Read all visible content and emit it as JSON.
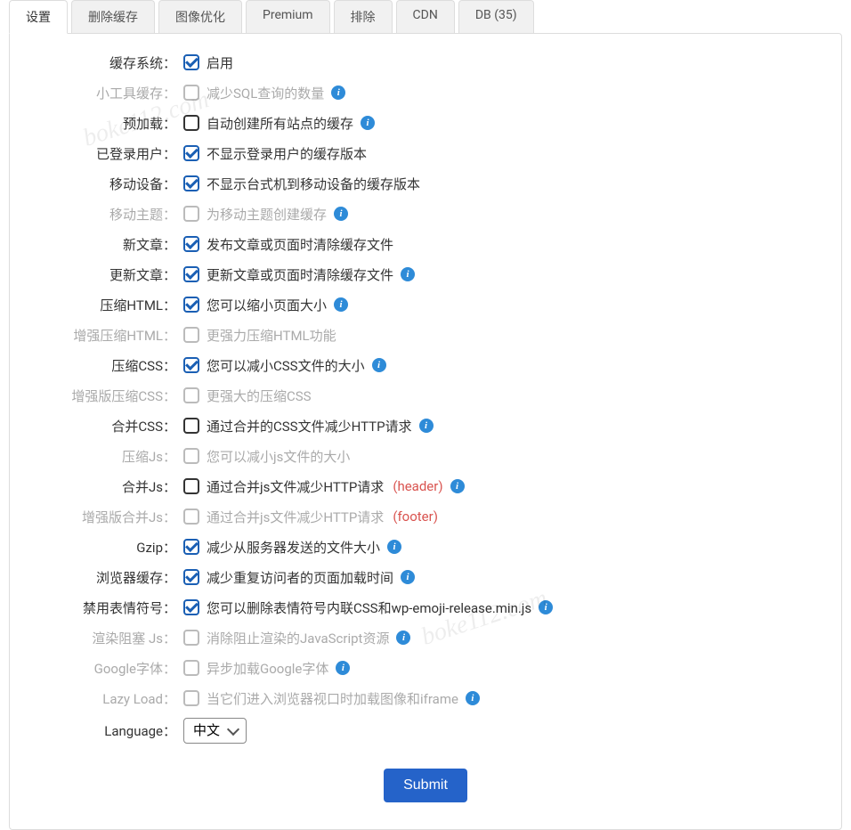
{
  "tabs": [
    {
      "label": "设置",
      "active": true
    },
    {
      "label": "删除缓存",
      "active": false
    },
    {
      "label": "图像优化",
      "active": false
    },
    {
      "label": "Premium",
      "active": false
    },
    {
      "label": "排除",
      "active": false
    },
    {
      "label": "CDN",
      "active": false
    },
    {
      "label": "DB (35)",
      "active": false
    }
  ],
  "watermark": "boke112.com",
  "rows": [
    {
      "name": "cache-system",
      "label": "缓存系统：",
      "muted": false,
      "checked": true,
      "desc": "启用",
      "info": false
    },
    {
      "name": "widget-cache",
      "label": "小工具缓存：",
      "muted": true,
      "checked": false,
      "desc": "减少SQL查询的数量",
      "info": true
    },
    {
      "name": "preload",
      "label": "预加载：",
      "muted": false,
      "checked": false,
      "desc": "自动创建所有站点的缓存",
      "info": true
    },
    {
      "name": "logged-in-users",
      "label": "已登录用户：",
      "muted": false,
      "checked": true,
      "desc": "不显示登录用户的缓存版本",
      "info": false
    },
    {
      "name": "mobile",
      "label": "移动设备：",
      "muted": false,
      "checked": true,
      "desc": "不显示台式机到移动设备的缓存版本",
      "info": false
    },
    {
      "name": "mobile-theme",
      "label": "移动主题：",
      "muted": true,
      "checked": false,
      "desc": "为移动主题创建缓存",
      "info": true
    },
    {
      "name": "new-post",
      "label": "新文章：",
      "muted": false,
      "checked": true,
      "desc": "发布文章或页面时清除缓存文件",
      "info": false
    },
    {
      "name": "update-post",
      "label": "更新文章：",
      "muted": false,
      "checked": true,
      "desc": "更新文章或页面时清除缓存文件",
      "info": true
    },
    {
      "name": "minify-html",
      "label": "压缩HTML：",
      "muted": false,
      "checked": true,
      "desc": "您可以缩小页面大小",
      "info": true
    },
    {
      "name": "minify-html-plus",
      "label": "增强压缩HTML：",
      "muted": true,
      "checked": false,
      "desc": "更强力压缩HTML功能",
      "info": false
    },
    {
      "name": "minify-css",
      "label": "压缩CSS：",
      "muted": false,
      "checked": true,
      "desc": "您可以减小CSS文件的大小",
      "info": true
    },
    {
      "name": "minify-css-plus",
      "label": "增强版压缩CSS：",
      "muted": true,
      "checked": false,
      "desc": "更强大的压缩CSS",
      "info": false
    },
    {
      "name": "combine-css",
      "label": "合并CSS：",
      "muted": false,
      "checked": false,
      "desc": "通过合并的CSS文件减少HTTP请求",
      "info": true
    },
    {
      "name": "minify-js",
      "label": "压缩Js：",
      "muted": true,
      "checked": false,
      "desc": "您可以减小js文件的大小",
      "info": false
    },
    {
      "name": "combine-js",
      "label": "合并Js：",
      "muted": false,
      "checked": false,
      "desc": "通过合并js文件减少HTTP请求",
      "extra": "(header)",
      "info": true
    },
    {
      "name": "combine-js-plus",
      "label": "增强版合并Js：",
      "muted": true,
      "checked": false,
      "desc": "通过合并js文件减少HTTP请求",
      "extra": "(footer)",
      "info": false
    },
    {
      "name": "gzip",
      "label": "Gzip：",
      "muted": false,
      "checked": true,
      "desc": "减少从服务器发送的文件大小",
      "info": true
    },
    {
      "name": "browser-caching",
      "label": "浏览器缓存：",
      "muted": false,
      "checked": true,
      "desc": "减少重复访问者的页面加载时间",
      "info": true
    },
    {
      "name": "disable-emojis",
      "label": "禁用表情符号：",
      "muted": false,
      "checked": true,
      "desc": "您可以删除表情符号内联CSS和wp-emoji-release.min.js",
      "info": true
    },
    {
      "name": "render-blocking-js",
      "label": "渲染阻塞 Js：",
      "muted": true,
      "checked": false,
      "desc": "消除阻止渲染的JavaScript资源",
      "info": true
    },
    {
      "name": "google-fonts",
      "label": "Google字体：",
      "muted": true,
      "checked": false,
      "desc": "异步加载Google字体",
      "info": true
    },
    {
      "name": "lazy-load",
      "label": "Lazy Load：",
      "muted": true,
      "checked": false,
      "desc": "当它们进入浏览器视口时加载图像和iframe",
      "info": true
    }
  ],
  "language": {
    "label": "Language：",
    "value": "中文"
  },
  "submit": {
    "label": "Submit"
  }
}
